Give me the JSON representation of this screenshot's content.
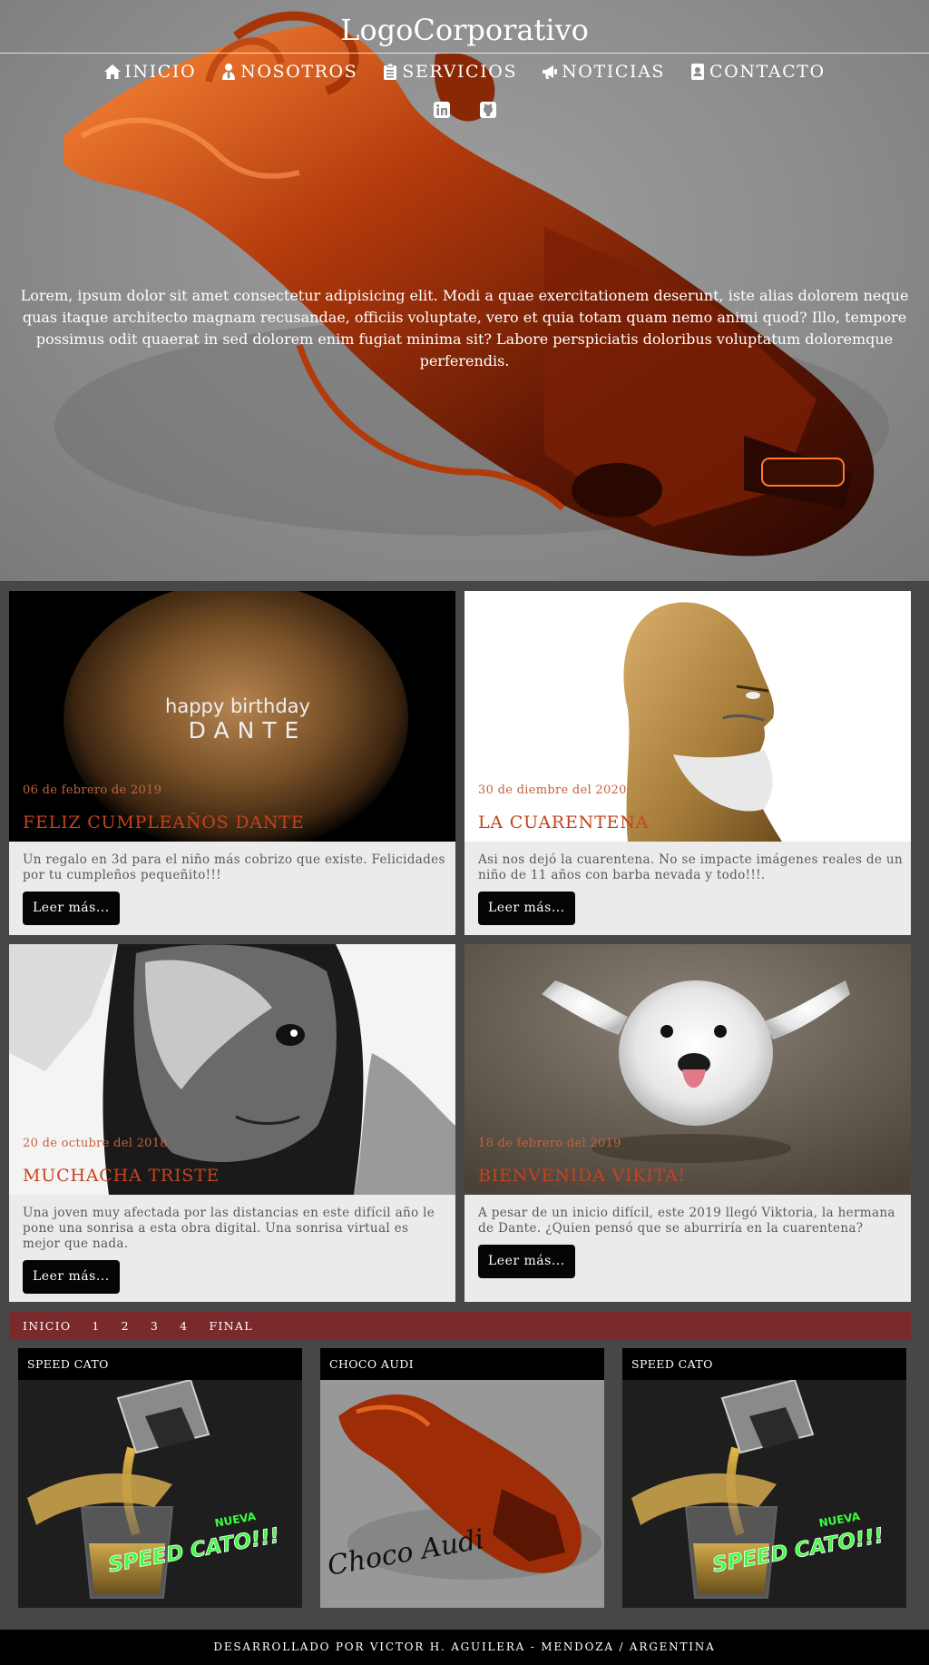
{
  "header": {
    "logo": "LogoCorporativo",
    "nav": [
      {
        "label": "INICIO",
        "icon": "home-icon"
      },
      {
        "label": "NOSOTROS",
        "icon": "user-tie-icon"
      },
      {
        "label": "SERVICIOS",
        "icon": "clipboard-list-icon"
      },
      {
        "label": "NOTICIAS",
        "icon": "bullhorn-icon"
      },
      {
        "label": "CONTACTO",
        "icon": "address-card-icon"
      }
    ],
    "social": [
      "linkedin-icon",
      "github-icon"
    ]
  },
  "hero": {
    "text": "Lorem, ipsum dolor sit amet consectetur adipisicing elit. Modi a quae exercitationem deserunt, iste alias dolorem neque quas itaque architecto magnam recusandae, officiis voluptate, vero et quia totam quam nemo animi quod? Illo, tempore possimus odit quaerat in sed dolorem enim fugiat minima sit? Labore perspiciatis doloribus voluptatum doloremque perferendis."
  },
  "articles": [
    {
      "date": "06 de febrero de 2019",
      "title": "FELIZ CUMPLEAÑOS DANTE",
      "body": "Un regalo en 3d para el niño más cobrizo que existe. Felicidades por tu cumpleños pequeñito!!!",
      "button": "Leer más...",
      "image_text_line1": "happy birthday",
      "image_text_line2": "DANTE"
    },
    {
      "date": "30 de diembre del 2020",
      "title": "LA CUARENTENA",
      "body": "Asi nos dejó la cuarentena. No se impacte imágenes reales de un niño de 11 años con barba nevada y todo!!!.",
      "button": "Leer más..."
    },
    {
      "date": "20 de octubre del 2018",
      "title": "MUCHACHA TRISTE",
      "body": "Una joven muy afectada por las distancias en este difícil año le pone una sonrisa a esta obra digital. Una sonrisa virtual es mejor que nada.",
      "button": "Leer más..."
    },
    {
      "date": "18 de febrero del 2019",
      "title": "BIENVENIDA VIKITA!",
      "body": "A pesar de un inicio difícil, este 2019 llegó Viktoria, la hermana de Dante. ¿Quien pensó que se aburriría en la cuarentena?",
      "button": "Leer más..."
    }
  ],
  "pagination": [
    "INICIO",
    "1",
    "2",
    "3",
    "4",
    "FINAL"
  ],
  "products": [
    {
      "label": "SPEED CATO",
      "badge_top": "NUEVA",
      "badge_main": "SPEED CATO!!!"
    },
    {
      "label": "CHOCO AUDI",
      "signature": "Choco Audi"
    },
    {
      "label": "SPEED CATO",
      "badge_top": "NUEVA",
      "badge_main": "SPEED CATO!!!"
    }
  ],
  "footer": {
    "text": "DESARROLLADO POR VICTOR H. AGUILERA - MENDOZA / ARGENTINA"
  },
  "colors": {
    "accent_title": "#c5431d",
    "accent_date": "#c5623a",
    "pager_bg": "#7a2a2a",
    "page_bg": "#474747",
    "card_bg": "#ebebeb",
    "badge_green": "#3cff3c"
  }
}
